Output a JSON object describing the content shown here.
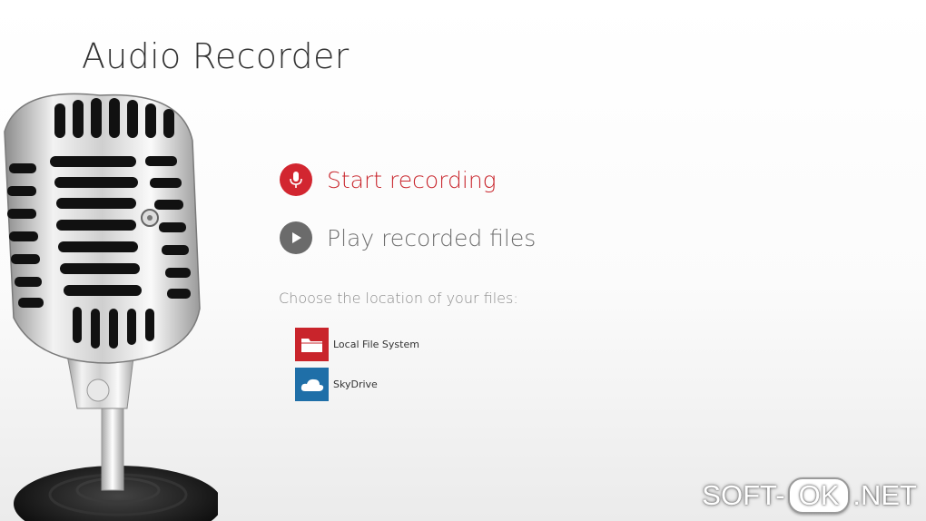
{
  "app": {
    "title": "Audio Recorder"
  },
  "actions": {
    "start_recording": "Start recording",
    "play_recorded_files": "Play recorded files"
  },
  "locations": {
    "heading": "Choose the location of your files:",
    "local": {
      "label": "Local File System",
      "icon": "folder-icon"
    },
    "skydrive": {
      "label": "SkyDrive",
      "icon": "skydrive-cloud-icon"
    }
  },
  "watermark": {
    "left": "SOFT-",
    "middle": "OK",
    "right": ".NET"
  },
  "colors": {
    "accent_red": "#d22630",
    "play_gray": "#6b6b6b",
    "skydrive_blue": "#1f6fa8"
  }
}
